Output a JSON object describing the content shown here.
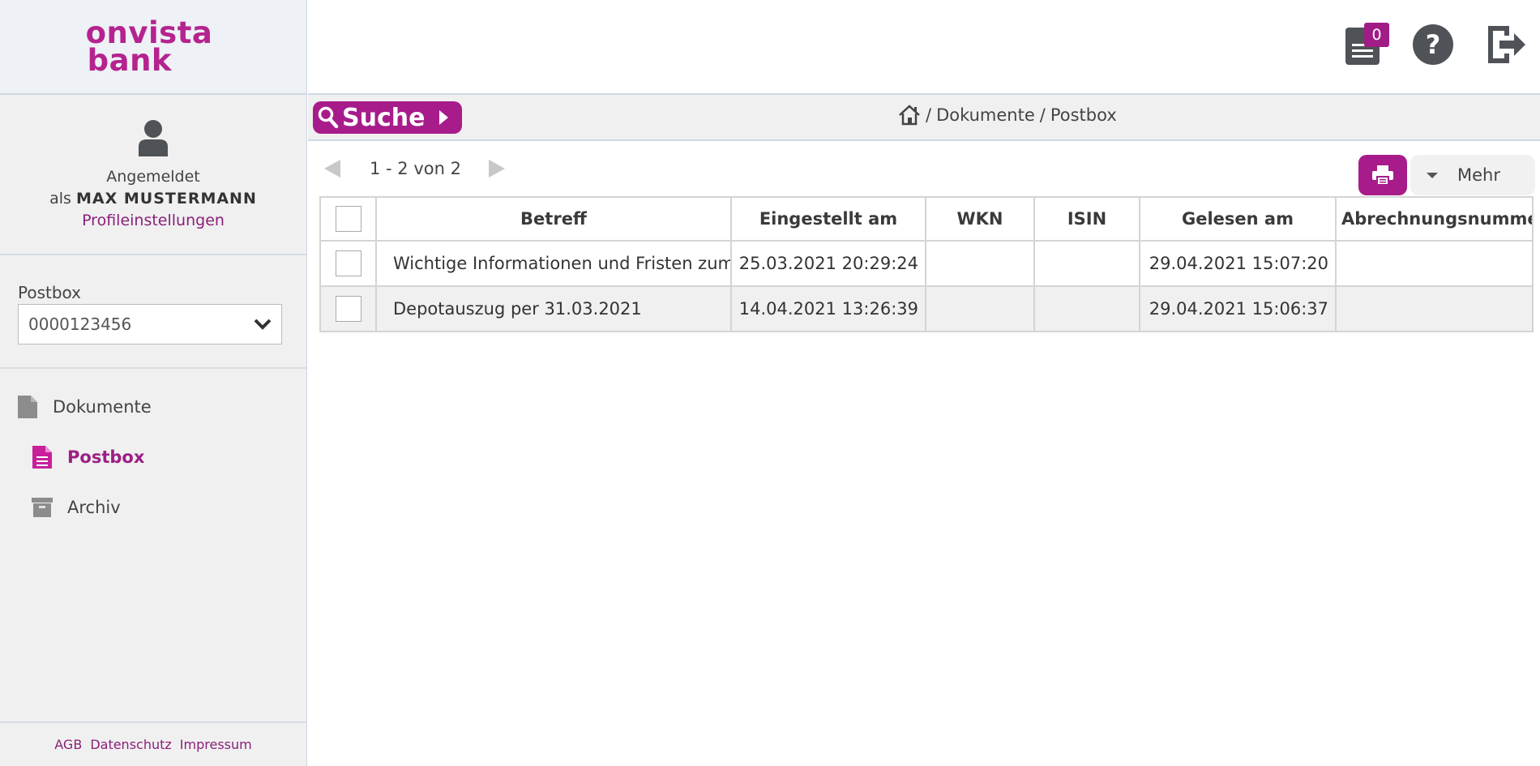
{
  "brand": {
    "line1": "onvista",
    "line2": "bank",
    "color": "#b5238f",
    "accent": "#a71c8a"
  },
  "user": {
    "logged_in": "Angemeldet",
    "as": "als",
    "name": "MAX MUSTERMANN",
    "profile_link": "Profileinstellungen"
  },
  "postbox": {
    "label": "Postbox",
    "selected": "0000123456"
  },
  "nav": {
    "items": [
      {
        "label": "Dokumente",
        "icon": "document-icon",
        "active": false
      },
      {
        "label": "Postbox",
        "icon": "document-lines-icon",
        "active": true
      },
      {
        "label": "Archiv",
        "icon": "archive-box-icon",
        "active": false
      }
    ]
  },
  "footer": {
    "agb": "AGB",
    "privacy": "Datenschutz",
    "imprint": "Impressum"
  },
  "header": {
    "messages_count": "0"
  },
  "toolbar": {
    "search_label": "Suche",
    "breadcrumb": {
      "sep": "/",
      "level1": "Dokumente",
      "level2": "Postbox"
    }
  },
  "pager": {
    "text": "1 - 2 von 2"
  },
  "actions": {
    "more_label": "Mehr"
  },
  "table": {
    "columns": [
      "Betreff",
      "Eingestellt am",
      "WKN",
      "ISIN",
      "Gelesen am",
      "Abrechnungsnummer"
    ],
    "rows": [
      {
        "subject": "Wichtige Informationen und Fristen zum Jahreswechsel",
        "posted": "25.03.2021 20:29:24",
        "wkn": "",
        "isin": "",
        "read": "29.04.2021 15:07:20",
        "number": ""
      },
      {
        "subject": "Depotauszug per 31.03.2021",
        "posted": "14.04.2021 13:26:39",
        "wkn": "",
        "isin": "",
        "read": "29.04.2021 15:06:37",
        "number": ""
      }
    ]
  }
}
